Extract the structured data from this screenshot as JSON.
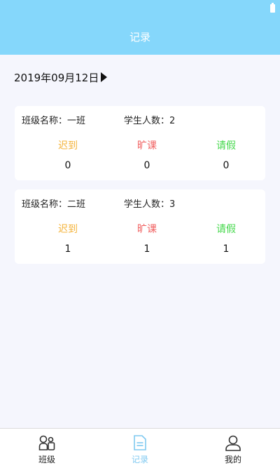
{
  "header": {
    "title": "记录"
  },
  "date": {
    "text": "2019年09月12日"
  },
  "records": [
    {
      "class_label": "班级名称：一班",
      "count_label": "学生人数：2",
      "late_label": "迟到",
      "late": "0",
      "absent_label": "旷课",
      "absent": "0",
      "leave_label": "请假",
      "leave": "0"
    },
    {
      "class_label": "班级名称：二班",
      "count_label": "学生人数：3",
      "late_label": "迟到",
      "late": "1",
      "absent_label": "旷课",
      "absent": "1",
      "leave_label": "请假",
      "leave": "1"
    }
  ],
  "nav": {
    "items": [
      {
        "label": "班级",
        "icon": "class-icon"
      },
      {
        "label": "记录",
        "icon": "record-icon"
      },
      {
        "label": "我的",
        "icon": "profile-icon"
      }
    ],
    "active_color": "#7fc9f0"
  },
  "colors": {
    "header": "#85d7fb",
    "late": "#f4b33a",
    "absent": "#f06060",
    "leave": "#44d84b"
  }
}
